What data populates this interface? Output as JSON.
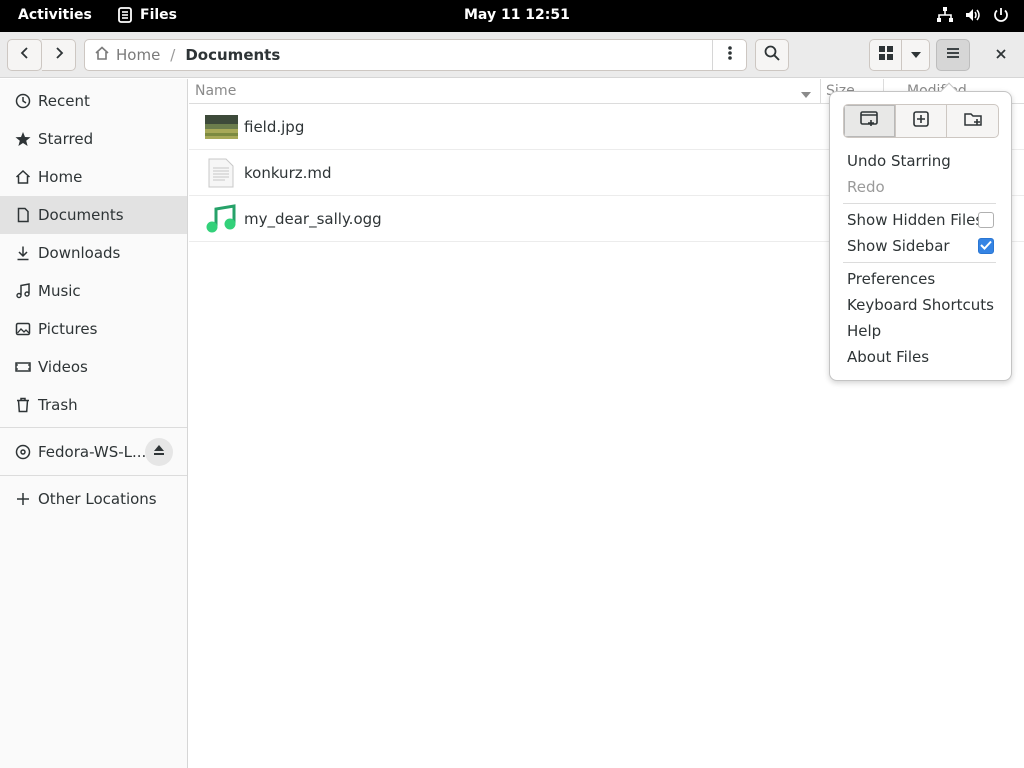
{
  "topbar": {
    "activities": "Activities",
    "app_name": "Files",
    "clock": "May 11  12:51"
  },
  "header": {
    "path": {
      "home": "Home",
      "current": "Documents"
    }
  },
  "sidebar": {
    "items": [
      {
        "label": "Recent",
        "icon": "clock-icon"
      },
      {
        "label": "Starred",
        "icon": "star-icon"
      },
      {
        "label": "Home",
        "icon": "home-icon"
      },
      {
        "label": "Documents",
        "icon": "document-icon",
        "active": true
      },
      {
        "label": "Downloads",
        "icon": "download-icon"
      },
      {
        "label": "Music",
        "icon": "music-icon"
      },
      {
        "label": "Pictures",
        "icon": "pictures-icon"
      },
      {
        "label": "Videos",
        "icon": "videos-icon"
      },
      {
        "label": "Trash",
        "icon": "trash-icon"
      }
    ],
    "drive": "Fedora-WS-L...",
    "other_locations": "Other Locations"
  },
  "filelist": {
    "columns": {
      "name": "Name",
      "size": "Size",
      "modified": "Modified"
    },
    "files": [
      {
        "name": "field.jpg",
        "icon": "image-thumbnail-icon"
      },
      {
        "name": "konkurz.md",
        "icon": "text-file-icon"
      },
      {
        "name": "my_dear_sally.ogg",
        "icon": "audio-file-icon"
      }
    ]
  },
  "menu": {
    "undo": "Undo Starring",
    "redo": "Redo",
    "show_hidden": "Show Hidden Files",
    "show_hidden_checked": false,
    "show_sidebar": "Show Sidebar",
    "show_sidebar_checked": true,
    "preferences": "Preferences",
    "shortcuts": "Keyboard Shortcuts",
    "help": "Help",
    "about": "About Files"
  },
  "colors": {
    "accent": "#3584e4",
    "topbar_bg": "#000000",
    "music_green": "#33d17a"
  }
}
